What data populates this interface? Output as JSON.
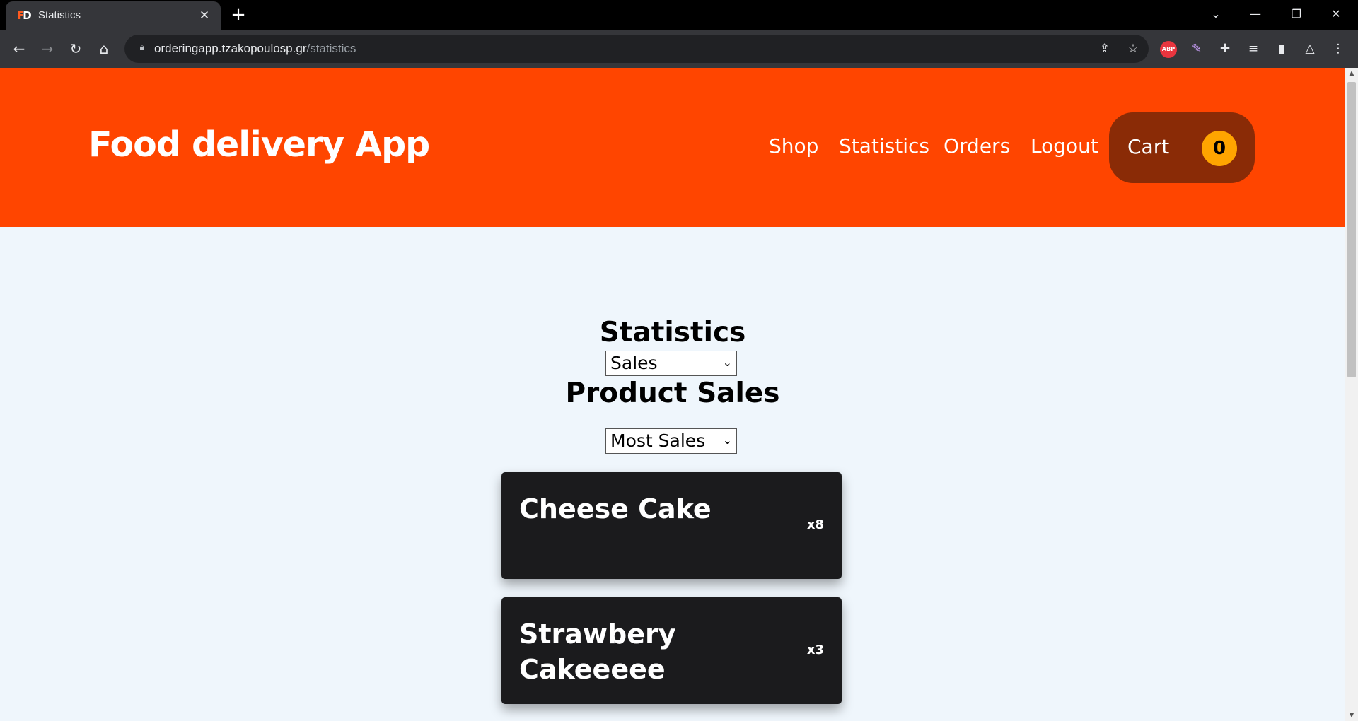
{
  "browser": {
    "tab_title": "Statistics",
    "tab_favicon": "FD",
    "url_host": "orderingapp.tzakopoulosp.gr",
    "url_path": "/statistics",
    "extension_abp": "ABP"
  },
  "header": {
    "brand": "Food delivery App",
    "nav": [
      "Shop",
      "Statistics",
      "Orders",
      "Logout"
    ],
    "cart_label": "Cart",
    "cart_count": "0"
  },
  "main": {
    "title": "Statistics",
    "stat_type_select": "Sales",
    "section_title": "Product Sales",
    "sort_select": "Most Sales",
    "products": [
      {
        "name": "Cheese Cake",
        "qty": "x8"
      },
      {
        "name": "Strawbery Cakeeeee",
        "qty": "x3"
      }
    ]
  },
  "colors": {
    "header_bg": "#ff4500",
    "cart_bg": "#8a2b06",
    "badge_bg": "#ffa500",
    "page_bg": "#eff6fc",
    "card_bg": "#1b1b1d"
  }
}
